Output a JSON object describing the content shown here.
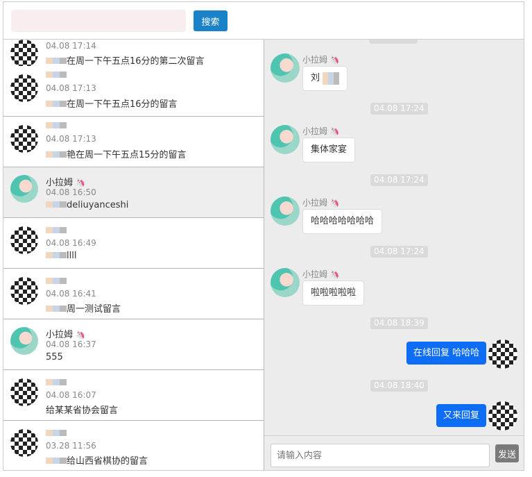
{
  "search": {
    "placeholder": "",
    "value": "",
    "button_label": "搜索"
  },
  "conversations": [
    {
      "name": "",
      "time": "04.08 17:14",
      "preview": "在周一下午五点16分的第二次留言",
      "avatar": "mosaic"
    },
    {
      "name": "",
      "time": "04.08 17:13",
      "preview": "在周一下午五点16分的留言",
      "avatar": "mosaic"
    },
    {
      "name": "",
      "time": "04.08 17:13",
      "preview": "艳在周一下午五点15分的留言",
      "avatar": "mosaic"
    },
    {
      "name": "小拉姆",
      "time": "04.08 16:50",
      "preview": "deliuyanceshi",
      "avatar": "anime",
      "selected": true
    },
    {
      "name": "",
      "time": "04.08 16:49",
      "preview": "llll",
      "avatar": "mosaic"
    },
    {
      "name": "",
      "time": "04.08 16:41",
      "preview": "周一测试留言",
      "avatar": "mosaic"
    },
    {
      "name": "小拉姆",
      "time": "04.08 16:37",
      "preview": "555",
      "avatar": "anime"
    },
    {
      "name": "",
      "time": "04.08 16:07",
      "preview": "给某某省协会留言",
      "avatar": "mosaic"
    },
    {
      "name": "",
      "time": "03.28 11:56",
      "preview": "给山西省棋协的留言",
      "avatar": "mosaic"
    }
  ],
  "chat": {
    "messages": [
      {
        "sender": "小拉姆",
        "text": "刘"
      },
      {
        "timestamp": "04.08 17:24"
      },
      {
        "sender": "小拉姆",
        "text": "集体家宴"
      },
      {
        "timestamp": "04.08 17:24"
      },
      {
        "sender": "小拉姆",
        "text": "哈哈哈哈哈哈哈"
      },
      {
        "timestamp": "04.08 17:24"
      },
      {
        "sender": "小拉姆",
        "text": "啦啦啦啦啦"
      },
      {
        "timestamp": "04.08 18:39"
      },
      {
        "mine": true,
        "text": "在线回复 哈哈哈"
      },
      {
        "timestamp": "04.08 18:40"
      },
      {
        "mine": true,
        "text": "又来回复"
      }
    ]
  },
  "composer": {
    "placeholder": "请输入内容",
    "send_label": "发送"
  },
  "unicorn_glyph": "🦄",
  "colors": {
    "search_button": "#1a82c9",
    "my_bubble": "#0d6ef5",
    "send_button": "#7a7a7a"
  }
}
